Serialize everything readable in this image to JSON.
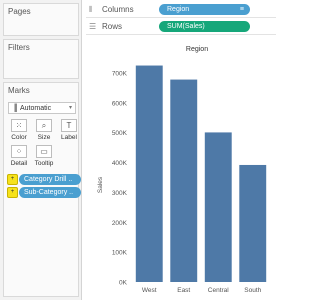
{
  "pages": {
    "title": "Pages"
  },
  "filters": {
    "title": "Filters"
  },
  "marks": {
    "title": "Marks",
    "mark_type": "Automatic",
    "buttons": [
      {
        "label": "Color",
        "icon": "color-palette-icon",
        "glyph": "⁙"
      },
      {
        "label": "Size",
        "icon": "size-magnifier-icon",
        "glyph": "⌕"
      },
      {
        "label": "Label",
        "icon": "label-text-icon",
        "glyph": "T"
      },
      {
        "label": "Detail",
        "icon": "detail-dots-icon",
        "glyph": "⁘"
      },
      {
        "label": "Tooltip",
        "icon": "tooltip-bubble-icon",
        "glyph": "▭"
      }
    ],
    "pills": [
      {
        "label": "Category Drill ..",
        "badge": "+"
      },
      {
        "label": "Sub-Category ..",
        "badge": "+"
      }
    ]
  },
  "shelves": {
    "columns": {
      "label": "Columns",
      "pill": "Region",
      "icon": "columns-icon"
    },
    "rows": {
      "label": "Rows",
      "pill": "SUM(Sales)",
      "icon": "rows-icon"
    }
  },
  "chart_data": {
    "type": "bar",
    "title": "Region",
    "ylabel": "Sales",
    "categories": [
      "West",
      "East",
      "Central",
      "South"
    ],
    "values": [
      725000,
      678000,
      501000,
      392000
    ],
    "ylim": [
      0,
      700000
    ],
    "yticks": [
      "0K",
      "100K",
      "200K",
      "300K",
      "400K",
      "500K",
      "600K",
      "700K"
    ],
    "bar_color": "#4e79a7",
    "grid": false
  },
  "colors": {
    "pill_dimension": "#4a9fd0",
    "pill_measure": "#16a77a",
    "drill_badge": "#f6e21b"
  }
}
